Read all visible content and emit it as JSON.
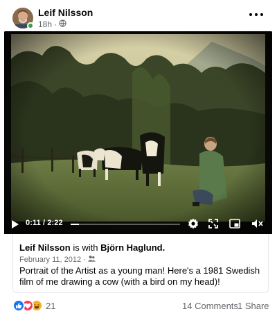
{
  "post": {
    "author": "Leif Nilsson",
    "time": "18h",
    "audience_icon": "globe-icon"
  },
  "video": {
    "current_time": "0:11",
    "separator": "/",
    "duration": "2:22",
    "progress_fraction": 0.077,
    "colors": {
      "sky": "#c9c49a",
      "trees": "#2f3a22",
      "grass": "#5e6e3c"
    }
  },
  "shared": {
    "author": "Leif Nilsson",
    "with_text": "is with",
    "tagged": "Björn Haglund.",
    "date": "February 11, 2012",
    "audience_icon": "friends-icon",
    "text": "Portrait of the Artist as a young man! Here's a 1981 Swedish film of me drawing a cow (with a bird on my head)!"
  },
  "footer": {
    "reactions": [
      "like-icon",
      "love-icon",
      "haha-icon"
    ],
    "reaction_count": "21",
    "comments": "14 Comments",
    "shares": "1 Share"
  },
  "colors": {
    "like": "#1877f2",
    "love": "#f33e58",
    "haha": "#f7b125",
    "online": "#31a24c"
  }
}
